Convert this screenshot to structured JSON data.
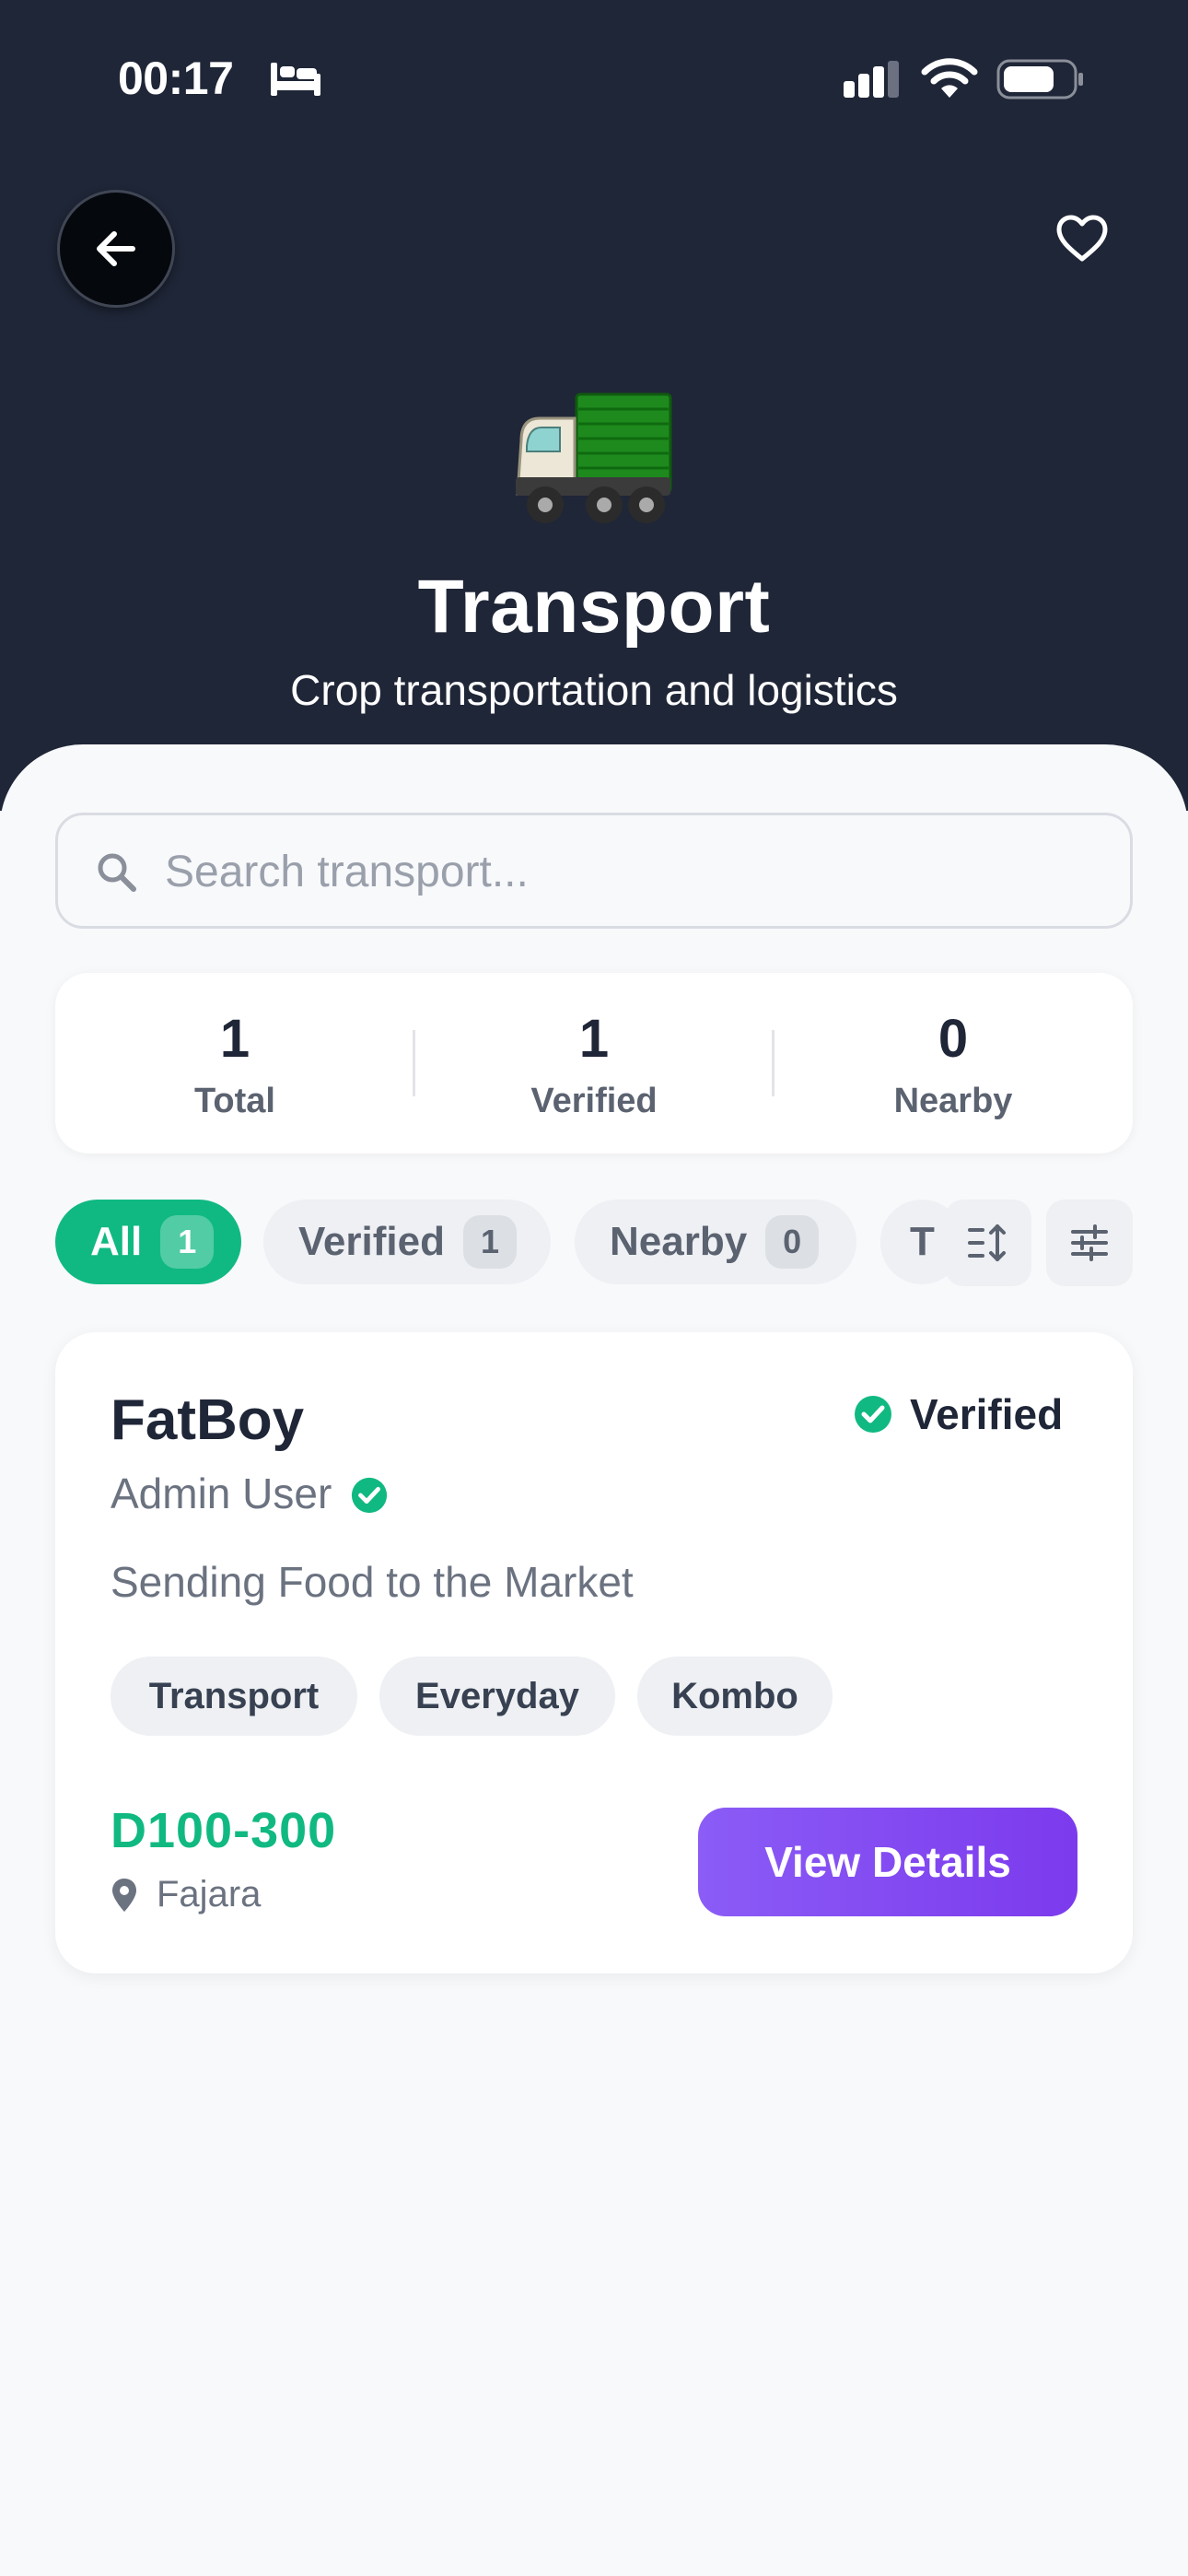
{
  "status_bar": {
    "time": "00:17",
    "icons": [
      "bed-icon",
      "signal-icon",
      "wifi-icon",
      "battery-icon"
    ]
  },
  "header": {
    "back_icon": "arrow-left-icon",
    "favorite_icon": "heart-outline-icon",
    "category_icon": "truck-emoji",
    "title": "Transport",
    "subtitle": "Crop transportation and logistics"
  },
  "search": {
    "placeholder": "Search transport...",
    "value": ""
  },
  "stats": [
    {
      "value": "1",
      "label": "Total"
    },
    {
      "value": "1",
      "label": "Verified"
    },
    {
      "value": "0",
      "label": "Nearby"
    }
  ],
  "filters": {
    "chips": [
      {
        "label": "All",
        "count": "1",
        "selected": true
      },
      {
        "label": "Verified",
        "count": "1",
        "selected": false
      },
      {
        "label": "Nearby",
        "count": "0",
        "selected": false
      },
      {
        "label": "T",
        "count": "",
        "selected": false
      }
    ],
    "sort_icon": "sort-icon",
    "filter_icon": "sliders-icon"
  },
  "listings": [
    {
      "title": "FatBoy",
      "badge": "Verified",
      "owner": "Admin User",
      "description": "Sending Food to the Market",
      "tags": [
        "Transport",
        "Everyday",
        "Kombo"
      ],
      "price": "D100-300",
      "location": "Fajara",
      "action": "View Details"
    }
  ],
  "colors": {
    "header_bg": "#1f2637",
    "accent_green": "#10b981",
    "button_purple": "#7c3aed",
    "page_bg": "#f8f9fb"
  }
}
